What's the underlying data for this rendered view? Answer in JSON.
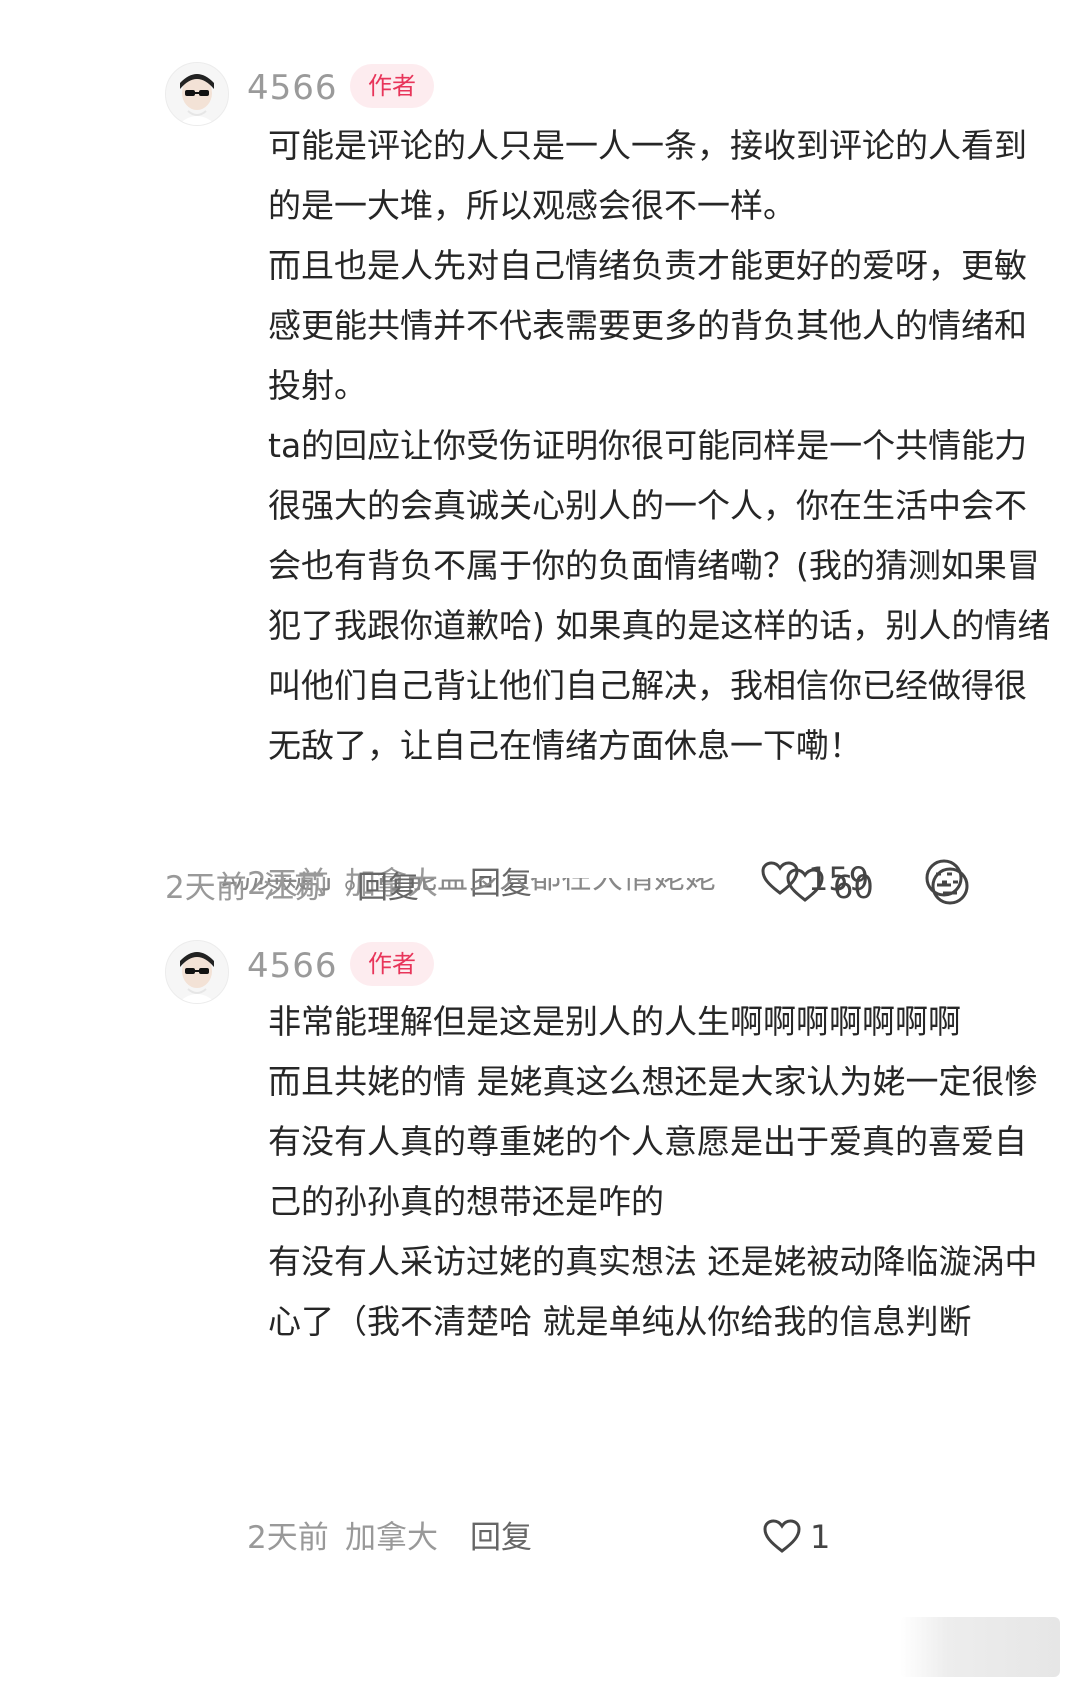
{
  "comments": [
    {
      "username": "4566",
      "badge": "作者",
      "paragraphs": [
        "可能是评论的人只是一人一条，接收到评论的人看到的是一大堆，所以观感会很不一样。",
        "而且也是人先对自己情绪负责才能更好的爱呀，更敏感更能共情并不代表需要更多的背负其他人的情绪和投射。",
        "ta的回应让你受伤证明你很可能同样是一个共情能力很强大的会真诚关心别人的一个人，你在生活中会不会也有背负不属于你的负面情绪嘞？(我的猜测如果冒犯了我跟你道歉哈) 如果真的是这样的话，别人的情绪叫他们自己背让他们自己解决，我相信你已经做得很无敌了，让自己在情绪方面休息一下嘞！"
      ],
      "time": "2天前",
      "location": "加拿大",
      "reply": "回复",
      "likes": "159"
    }
  ],
  "overlap_text": "动质疑了。可能盖多人都在大情姥姥",
  "previous_comment_footer": {
    "time": "2天前",
    "location": "江苏",
    "reply": "回复",
    "likes": "60"
  },
  "second_comment": {
    "username": "4566",
    "badge": "作者",
    "paragraphs": [
      "非常能理解但是这是别人的人生啊啊啊啊啊啊啊",
      "而且共姥的情 是姥真这么想还是大家认为姥一定很惨",
      "有没有人真的尊重姥的个人意愿是出于爱真的喜爱自己的孙孙真的想带还是咋的",
      "有没有人采访过姥的真实想法 还是姥被动降临漩涡中心了（我不清楚哈 就是单纯从你给我的信息判断"
    ],
    "time": "2天前",
    "location": "加拿大",
    "reply": "回复",
    "likes": "1"
  },
  "colors": {
    "badge_bg": "#fdecef",
    "badge_text": "#e8355a",
    "meta_text": "#999999",
    "body_text": "#262626"
  },
  "icons": [
    "avatar",
    "heart-icon",
    "neutral-face-icon"
  ]
}
